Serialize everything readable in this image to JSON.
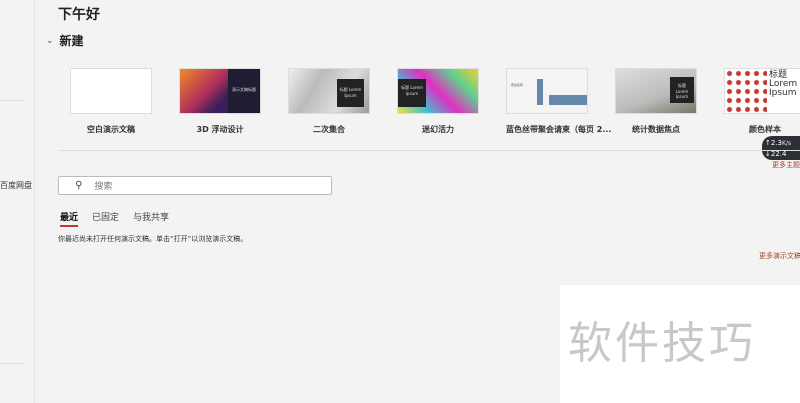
{
  "greeting": "下午好",
  "new_section": "新建",
  "sidebar": {
    "baidu": "百度网盘"
  },
  "templates": [
    {
      "label": "空白演示文稿",
      "thumb_text": ""
    },
    {
      "label": "3D 浮动设计",
      "thumb_text": "演示文稿标题"
    },
    {
      "label": "二次集合",
      "thumb_text": "标题 Lorem Ipsum"
    },
    {
      "label": "迷幻活力",
      "thumb_text": "标题 Lorem Ipsum"
    },
    {
      "label": "蓝色丝带聚会请柬（每页 2...",
      "thumb_text": "聚会名称"
    },
    {
      "label": "统计数据焦点",
      "thumb_text": "标题 Lorem Ipsum"
    },
    {
      "label": "颜色样本",
      "thumb_text": "标题 Lorem Ipsum"
    }
  ],
  "more_themes": "更多主题",
  "speed": {
    "up": "2.3",
    "down": "22.4",
    "unit": "K/s"
  },
  "search": {
    "placeholder": "搜索"
  },
  "tabs": [
    "最近",
    "已固定",
    "与我共享"
  ],
  "empty_message": "你最近尚未打开任何演示文稿。单击“打开”以浏览演示文稿。",
  "more_presentations": "更多演示文稿",
  "watermark": "软件技巧"
}
